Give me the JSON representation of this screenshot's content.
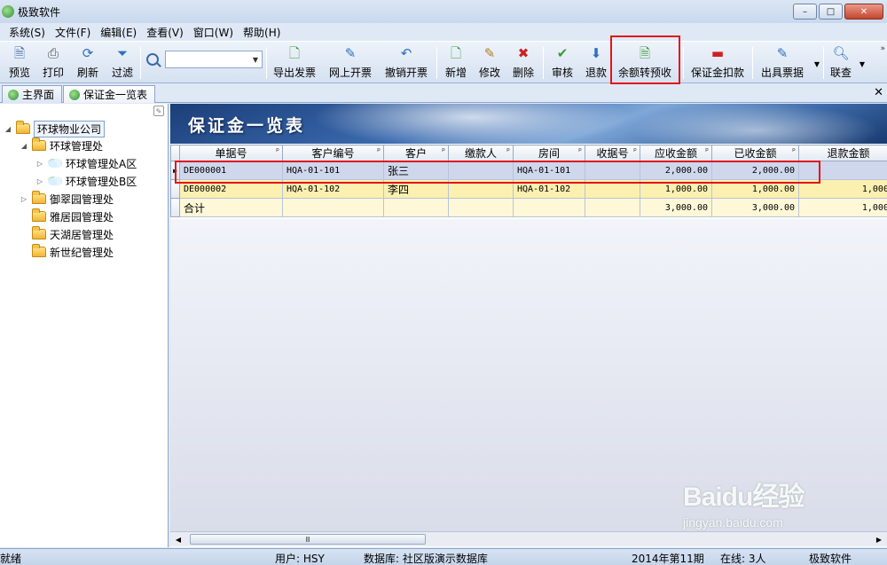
{
  "window": {
    "title": "极致软件",
    "min": "–",
    "max": "□",
    "close": "✕"
  },
  "menu": [
    "系统(S)",
    "文件(F)",
    "编辑(E)",
    "查看(V)",
    "窗口(W)",
    "帮助(H)"
  ],
  "toolbar": {
    "preview": "预览",
    "print": "打印",
    "refresh": "刷新",
    "filter": "过滤",
    "export_invoice": "导出发票",
    "online_invoice": "网上开票",
    "cancel_invoice": "撤销开票",
    "add": "新增",
    "edit": "修改",
    "delete": "删除",
    "audit": "审核",
    "refund": "退款",
    "balance_to_prepaid": "余额转预收",
    "deposit_deduct": "保证金扣款",
    "issue_bill": "出具票据",
    "linked_query": "联查",
    "search_value": ""
  },
  "tabs": {
    "home": "主界面",
    "deposit_list": "保证金一览表"
  },
  "tree": {
    "root": "环球物业公司",
    "n1": "环球管理处",
    "n1a": "环球管理处A区",
    "n1b": "环球管理处B区",
    "n2": "御翠园管理处",
    "n3": "雅居园管理处",
    "n4": "天湖居管理处",
    "n5": "新世纪管理处"
  },
  "banner_title": "保证金一览表",
  "grid": {
    "columns": [
      "单据号",
      "客户编号",
      "客户",
      "缴款人",
      "房间",
      "收据号",
      "应收金额",
      "已收金额",
      "退款金额"
    ],
    "rows": [
      {
        "doc": "DE000001",
        "cust_no": "HQA-01-101",
        "cust": "张三",
        "payer": "",
        "room": "HQA-01-101",
        "receipt": "",
        "due": "2,000.00",
        "received": "2,000.00",
        "refund": ""
      },
      {
        "doc": "DE000002",
        "cust_no": "HQA-01-102",
        "cust": "李四",
        "payer": "",
        "room": "HQA-01-102",
        "receipt": "",
        "due": "1,000.00",
        "received": "1,000.00",
        "refund": "1,000."
      }
    ],
    "total": {
      "label": "合计",
      "due": "3,000.00",
      "received": "3,000.00",
      "refund": "1,000."
    }
  },
  "scroll_thumb": "Ⅲ",
  "status": {
    "ready": "就绪",
    "user": "用户: HSY",
    "db": "数据库: 社区版演示数据库",
    "period": "2014年第11期",
    "online": "在线: 3人",
    "company": "极致软件"
  },
  "watermark": {
    "logo": "Baidu经验",
    "url": "jingyan.baidu.com"
  }
}
